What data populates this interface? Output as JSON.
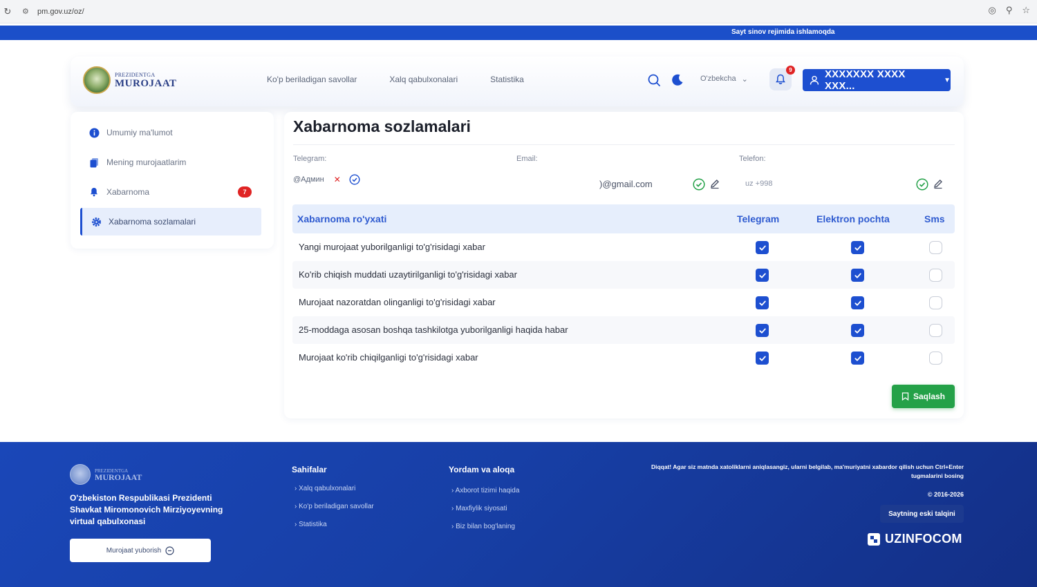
{
  "browser": {
    "url": "pm.gov.uz/oz/"
  },
  "banner": {
    "text": "Sayt sinov rejimida ishlamoqda"
  },
  "header": {
    "logo_line1": "PREZIDENTGA",
    "logo_line2": "MUROJAAT",
    "nav": [
      "Ko'p beriladigan savollar",
      "Xalq qabulxonalari",
      "Statistika"
    ],
    "language": "O'zbekcha",
    "notification_count": "9",
    "user_name": "XXXXXXX XXXX XXX..."
  },
  "sidebar": {
    "items": [
      {
        "label": "Umumiy ma'lumot",
        "icon": "info-icon"
      },
      {
        "label": "Mening murojaatlarim",
        "icon": "documents-icon"
      },
      {
        "label": "Xabarnoma",
        "icon": "bell-icon",
        "badge": "7"
      },
      {
        "label": "Xabarnoma sozlamalari",
        "icon": "gear-icon",
        "active": true
      }
    ]
  },
  "main": {
    "title": "Xabarnoma sozlamalari",
    "contacts": {
      "telegram_label": "Telegram:",
      "telegram_value": "@Админ",
      "email_label": "Email:",
      "email_value": ")@gmail.com",
      "phone_label": "Telefon:",
      "phone_value": "uz +998"
    },
    "table": {
      "headers": [
        "Xabarnoma ro'yxati",
        "Telegram",
        "Elektron pochta",
        "Sms"
      ],
      "rows": [
        {
          "label": "Yangi murojaat yuborilganligi to'g'risidagi xabar",
          "telegram": true,
          "email": true,
          "sms": false
        },
        {
          "label": "Ko'rib chiqish muddati uzaytirilganligi to'g'risidagi xabar",
          "telegram": true,
          "email": true,
          "sms": false
        },
        {
          "label": "Murojaat nazoratdan olinganligi to'g'risidagi xabar",
          "telegram": true,
          "email": true,
          "sms": false
        },
        {
          "label": "25-moddaga asosan boshqa tashkilotga yuborilganligi haqida habar",
          "telegram": true,
          "email": true,
          "sms": false
        },
        {
          "label": "Murojaat ko'rib chiqilganligi to'g'risidagi xabar",
          "telegram": true,
          "email": true,
          "sms": false
        }
      ]
    },
    "save_label": "Saqlash"
  },
  "footer": {
    "logo_line1": "PREZIDENTGA",
    "logo_line2": "MUROJAAT",
    "description": "O'zbekiston Respublikasi Prezidenti Shavkat Miromonovich Mirziyoyevning virtual qabulxonasi",
    "send_button": "Murojaat yuborish",
    "pages_title": "Sahifalar",
    "pages_links": [
      "Xalq qabulxonalari",
      "Ko'p beriladigan savollar",
      "Statistika"
    ],
    "help_title": "Yordam va aloqa",
    "help_links": [
      "Axborot tizimi haqida",
      "Maxfiylik siyosati",
      "Biz bilan bog'laning"
    ],
    "note": "Diqqat! Agar siz matnda xatoliklarni aniqlasangiz, ularni belgilab, ma'muriyatni xabardor qilish uchun Ctrl+Enter tugmalarini bosing",
    "copyright": "© 2016-2026",
    "old_site_button": "Saytning eski talqini",
    "brand": "UZINFOCOM"
  },
  "colors": {
    "primary": "#1d4fd0",
    "success": "#24a148",
    "danger": "#e02424",
    "footer": "#173fa6"
  }
}
